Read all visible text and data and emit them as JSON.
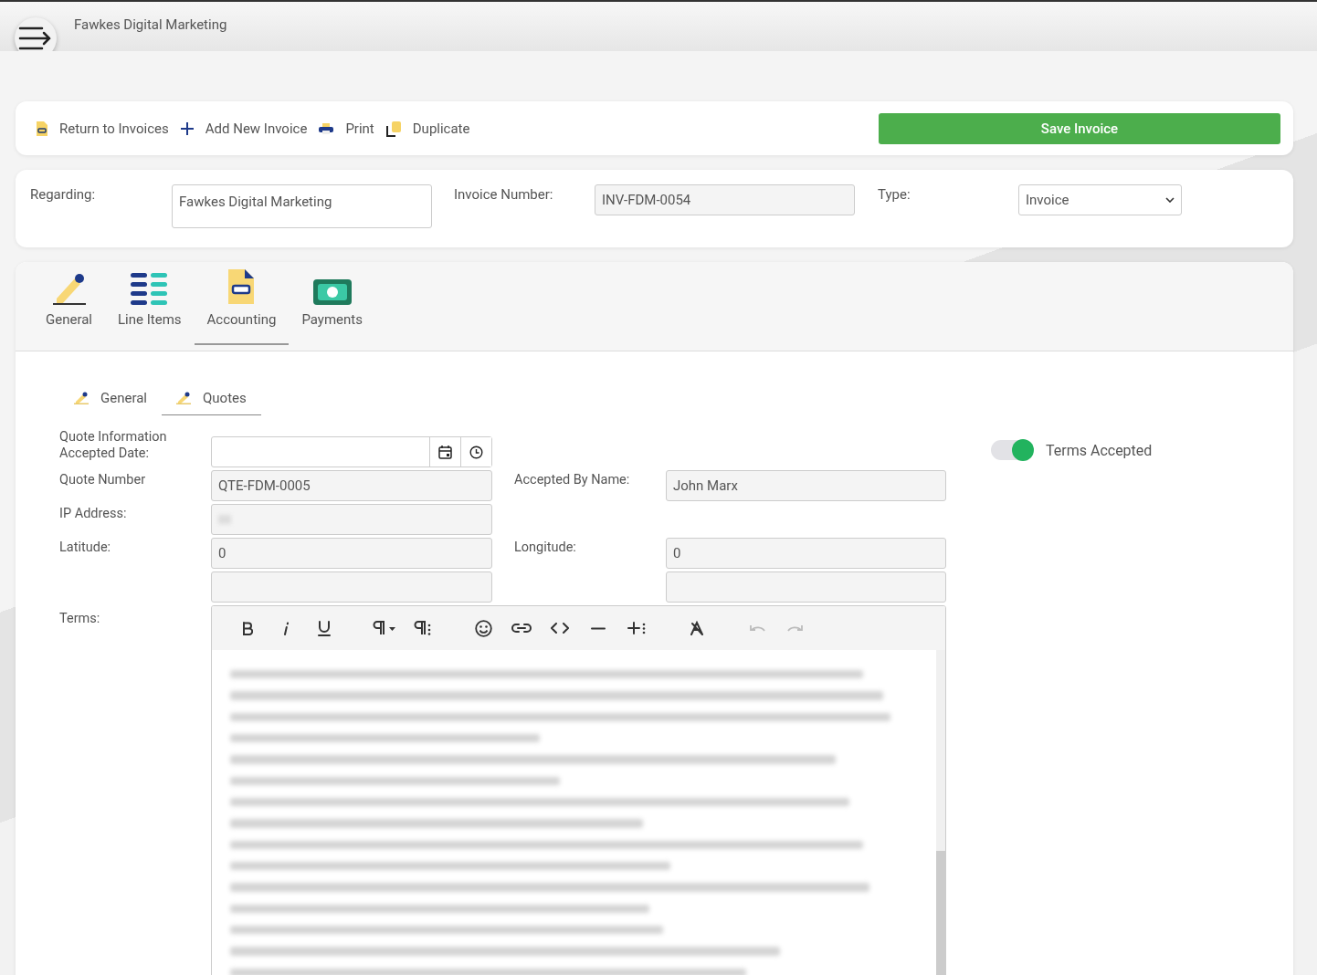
{
  "header": {
    "title": "Fawkes Digital Marketing"
  },
  "toolbar": {
    "actions": [
      {
        "label": "Return to Invoices",
        "kind": "return"
      },
      {
        "label": "Add New Invoice",
        "kind": "add"
      },
      {
        "label": "Print",
        "kind": "print"
      },
      {
        "label": "Duplicate",
        "kind": "duplicate"
      }
    ],
    "save_button": "Save Invoice"
  },
  "invoice": {
    "regarding_label": "Regarding:",
    "regarding_value": "Fawkes Digital Marketing",
    "number_label": "Invoice Number:",
    "number_value": "INV-FDM-0054",
    "type_label": "Type:",
    "type_value": "Invoice"
  },
  "tabs": [
    {
      "label": "General",
      "kind": "pencil",
      "selected": false
    },
    {
      "label": "Line Items",
      "kind": "list",
      "selected": false
    },
    {
      "label": "Accounting",
      "kind": "document",
      "selected": true
    },
    {
      "label": "Payments",
      "kind": "money",
      "selected": false
    }
  ],
  "subtabs": [
    {
      "label": "General",
      "selected": false
    },
    {
      "label": "Quotes",
      "selected": true
    }
  ],
  "quote": {
    "accepted_date_label": "Quote Information Accepted Date:",
    "quote_number_label": "Quote Number",
    "quote_number_value": "QTE-FDM-0005",
    "accepted_by_label": "Accepted By Name:",
    "accepted_by_value": "John Marx",
    "ip_label": "IP Address:",
    "latitude_label": "Latitude:",
    "latitude_value": "0",
    "longitude_label": "Longitude:",
    "longitude_value": "0",
    "terms_label": "Terms:"
  },
  "terms_accepted": {
    "label": "Terms Accepted",
    "on": true
  }
}
